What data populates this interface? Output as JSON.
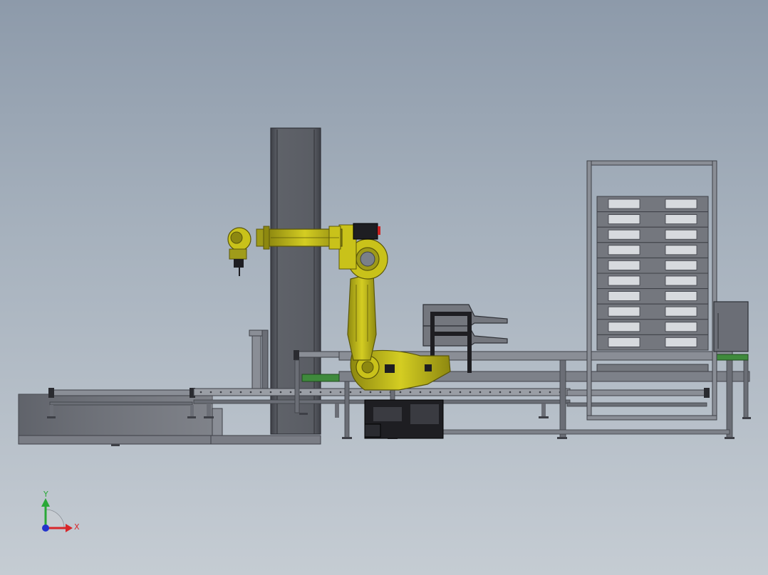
{
  "viewport": {
    "background_top": "#8d9aaa",
    "background_bottom": "#c5ccd3"
  },
  "model": {
    "colors": {
      "frame": "#5c5f66",
      "frame_light": "#8a8e96",
      "frame_dark": "#3e4047",
      "robot_yellow": "#c9c21a",
      "robot_yellow_dark": "#8d8810",
      "robot_black": "#1e1e22",
      "roller_green": "#3f8a3c",
      "tray": "#74777e",
      "slot": "#d7dade"
    },
    "rack_levels": 10
  },
  "triad": {
    "x_label": "X",
    "y_label": "Y",
    "x_color": "#d8262a",
    "y_color": "#2aa838",
    "z_color": "#2233cc"
  }
}
